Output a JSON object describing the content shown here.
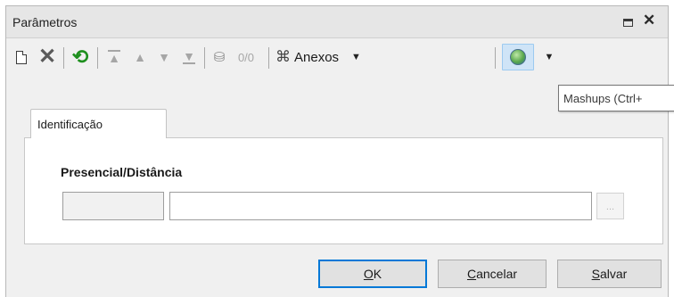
{
  "window": {
    "title": "Parâmetros"
  },
  "toolbar": {
    "record_counter": "0/0",
    "attachments_label": "Anexos"
  },
  "tooltip": {
    "text": "Mashups (Ctrl+"
  },
  "tabs": [
    {
      "label": "Identificação",
      "active": true
    }
  ],
  "form": {
    "field_label": "Presencial/Distância",
    "code_value": "",
    "description_value": "",
    "lookup_label": "..."
  },
  "buttons": {
    "ok_accel": "O",
    "ok_rest": "K",
    "cancel_accel": "C",
    "cancel_rest": "ancelar",
    "save_accel": "S",
    "save_rest": "alvar"
  },
  "icons": {
    "new": "new-document-icon",
    "delete": "delete-x-icon",
    "refresh": "refresh-icon",
    "first": "first-record-icon",
    "previous": "previous-record-icon",
    "next": "next-record-icon",
    "last": "last-record-icon",
    "search": "binoculars-icon",
    "attachments": "paperclip-icon",
    "mashups": "globe-icon"
  },
  "colors": {
    "focus_border": "#0078d7",
    "refresh_green": "#1e8f1e",
    "mashups_highlight": "#cfe4f7"
  }
}
